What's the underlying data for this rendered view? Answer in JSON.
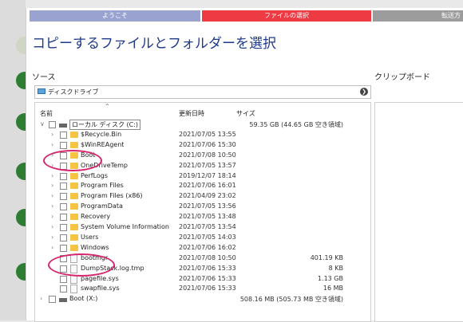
{
  "steps": [
    "ようこそ",
    "ファイルの選択",
    "転送方"
  ],
  "title": "コピーするファイルとフォルダーを選択",
  "source_label": "ソース",
  "clipboard_label": "クリップボード",
  "dropdown": {
    "icon": "monitor-icon",
    "value": "ディスクドライブ"
  },
  "columns": {
    "name": "名前",
    "date": "更新日時",
    "size": "サイズ"
  },
  "rows": [
    {
      "type": "drive",
      "name": "ローカル ディスク (C:)",
      "date": "",
      "size": "59.35 GB (44.65 GB 空き領域)",
      "expand": "v",
      "level": 0
    },
    {
      "type": "folder",
      "name": "$Recycle.Bin",
      "date": "2021/07/05 13:55",
      "size": "",
      "expand": ">",
      "level": 1
    },
    {
      "type": "folder",
      "name": "$WinREAgent",
      "date": "2021/07/06 15:30",
      "size": "",
      "expand": ">",
      "level": 1
    },
    {
      "type": "folder",
      "name": "Boot",
      "date": "2021/07/08 10:50",
      "size": "",
      "expand": ">",
      "level": 1
    },
    {
      "type": "folder",
      "name": "OneDriveTemp",
      "date": "2021/07/05 13:57",
      "size": "",
      "expand": ">",
      "level": 1
    },
    {
      "type": "folder",
      "name": "PerfLogs",
      "date": "2019/12/07 18:14",
      "size": "",
      "expand": ">",
      "level": 1
    },
    {
      "type": "folder",
      "name": "Program Files",
      "date": "2021/07/06 16:01",
      "size": "",
      "expand": ">",
      "level": 1
    },
    {
      "type": "folder",
      "name": "Program Files (x86)",
      "date": "2021/04/09 23:02",
      "size": "",
      "expand": ">",
      "level": 1
    },
    {
      "type": "folder",
      "name": "ProgramData",
      "date": "2021/07/05 13:56",
      "size": "",
      "expand": ">",
      "level": 1
    },
    {
      "type": "folder",
      "name": "Recovery",
      "date": "2021/07/05 13:48",
      "size": "",
      "expand": ">",
      "level": 1
    },
    {
      "type": "folder",
      "name": "System Volume Information",
      "date": "2021/07/05 13:54",
      "size": "",
      "expand": ">",
      "level": 1
    },
    {
      "type": "folder",
      "name": "Users",
      "date": "2021/07/05 14:03",
      "size": "",
      "expand": ">",
      "level": 1
    },
    {
      "type": "folder",
      "name": "Windows",
      "date": "2021/07/06 16:02",
      "size": "",
      "expand": ">",
      "level": 1
    },
    {
      "type": "file",
      "name": "bootmgr",
      "date": "2021/07/08 10:50",
      "size": "401.19 KB",
      "expand": "",
      "level": 1
    },
    {
      "type": "file",
      "name": "DumpStack.log.tmp",
      "date": "2021/07/06 15:33",
      "size": "8 KB",
      "expand": "",
      "level": 1
    },
    {
      "type": "file",
      "name": "pagefile.sys",
      "date": "2021/07/06 15:33",
      "size": "1.13 GB",
      "expand": "",
      "level": 1
    },
    {
      "type": "file",
      "name": "swapfile.sys",
      "date": "2021/07/06 15:33",
      "size": "16 MB",
      "expand": "",
      "level": 1
    },
    {
      "type": "drive",
      "name": "Boot (X:)",
      "date": "",
      "size": "508.16 MB (505.73 MB 空き領域)",
      "expand": ">",
      "level": 0
    }
  ],
  "colors": {
    "step_welcome": "#9aa3cf",
    "step_select": "#ee3a43",
    "step_transfer": "#9c9c9c",
    "title": "#1f3a8a",
    "highlight": "#d6266e",
    "folder": "#f6c342"
  }
}
